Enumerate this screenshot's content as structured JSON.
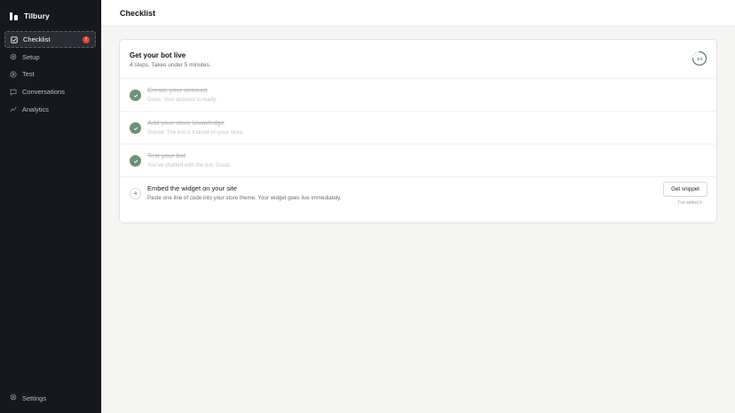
{
  "app": {
    "name": "Tilbury"
  },
  "sidebar": {
    "items": [
      {
        "label": "Checklist",
        "icon": "checklist-icon",
        "badge": "!"
      },
      {
        "label": "Setup",
        "icon": "gear-icon"
      },
      {
        "label": "Test",
        "icon": "play-icon"
      },
      {
        "label": "Conversations",
        "icon": "chat-icon"
      },
      {
        "label": "Analytics",
        "icon": "chart-icon"
      }
    ],
    "settings_label": "Settings"
  },
  "header": {
    "title": "Checklist"
  },
  "card": {
    "title": "Get your bot live",
    "subtitle": "4 steps. Takes under 5 minutes.",
    "progress": {
      "label": "3/4",
      "value": 0.75
    },
    "steps": [
      {
        "title": "Create your account",
        "desc": "Done. Your account is ready.",
        "done": true
      },
      {
        "title": "Add your store knowledge",
        "desc": "Stored. The bot is trained on your store.",
        "done": true
      },
      {
        "title": "Test your bot",
        "desc": "You've chatted with the bot. Great.",
        "done": true
      },
      {
        "number": "4",
        "title": "Embed the widget on your site",
        "desc": "Paste one line of code into your store theme. Your widget goes live immediately.",
        "done": false
      }
    ],
    "snippet_button": "Get snippet",
    "added_link": "I've added it"
  },
  "colors": {
    "sidebar_bg": "#16181d",
    "accent_green": "#6f9077",
    "badge_red": "#e0453a"
  }
}
